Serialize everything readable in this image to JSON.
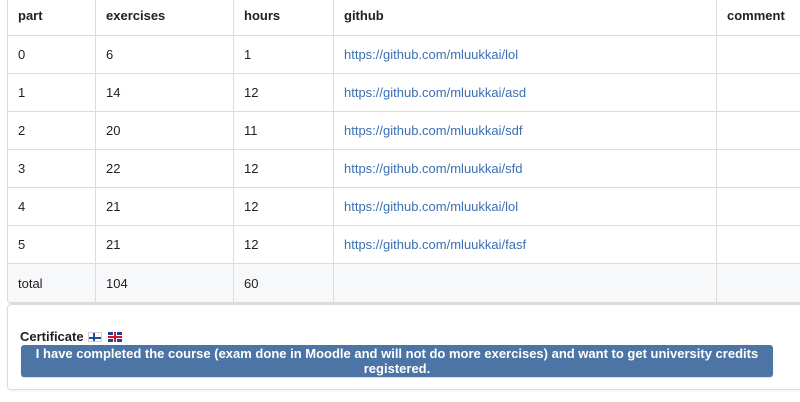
{
  "table": {
    "headers": [
      "part",
      "exercises",
      "hours",
      "github",
      "comment"
    ],
    "rows": [
      {
        "part": "0",
        "exercises": "6",
        "hours": "1",
        "github": "https://github.com/mluukkai/lol",
        "comment": ""
      },
      {
        "part": "1",
        "exercises": "14",
        "hours": "12",
        "github": "https://github.com/mluukkai/asd",
        "comment": ""
      },
      {
        "part": "2",
        "exercises": "20",
        "hours": "11",
        "github": "https://github.com/mluukkai/sdf",
        "comment": ""
      },
      {
        "part": "3",
        "exercises": "22",
        "hours": "12",
        "github": "https://github.com/mluukkai/sfd",
        "comment": ""
      },
      {
        "part": "4",
        "exercises": "21",
        "hours": "12",
        "github": "https://github.com/mluukkai/lol",
        "comment": ""
      },
      {
        "part": "5",
        "exercises": "21",
        "hours": "12",
        "github": "https://github.com/mluukkai/fasf",
        "comment": ""
      }
    ],
    "total": {
      "label": "total",
      "exercises": "104",
      "hours": "60"
    }
  },
  "certificate": {
    "label": "Certificate",
    "flags": [
      "finland-flag-icon",
      "uk-flag-icon"
    ],
    "button_label": "I have completed the course (exam done in Moodle and will not do more exercises) and want to get university credits registered."
  },
  "colors": {
    "link": "#3a70b3",
    "button_bg": "#4c74a4",
    "button_text": "#ffffff"
  }
}
